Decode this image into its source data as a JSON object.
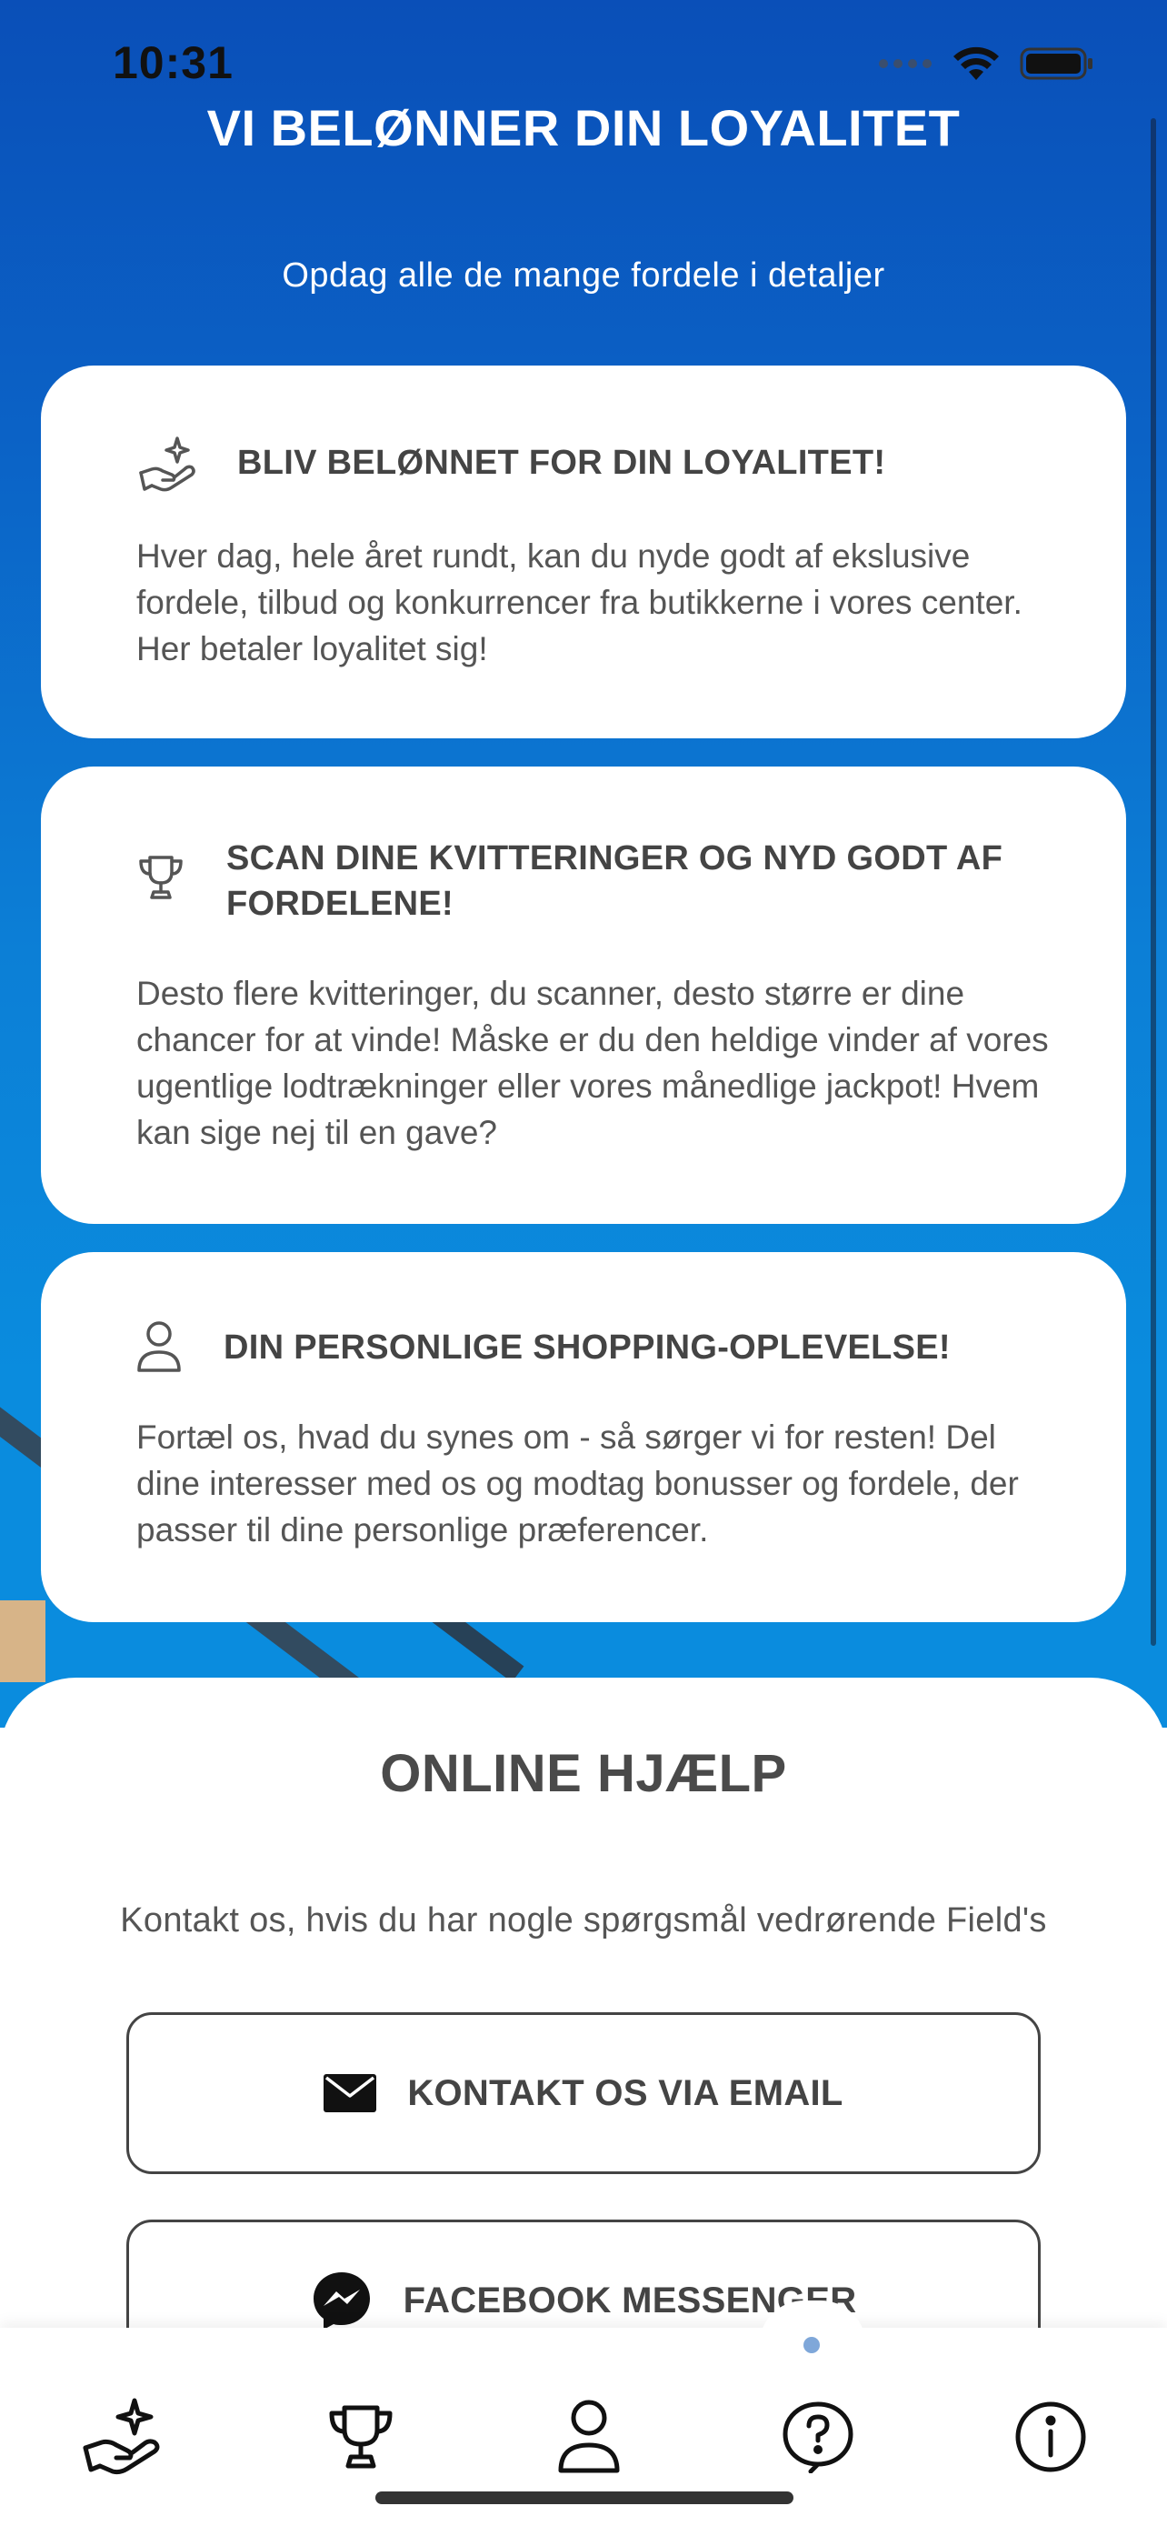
{
  "status_bar": {
    "time": "10:31"
  },
  "hero": {
    "title": "VI BELØNNER DIN LOYALITET",
    "subtitle": "Opdag alle de mange fordele i detaljer"
  },
  "cards": [
    {
      "icon": "hand-sparkle-icon",
      "title": "BLIV BELØNNET FOR DIN LOYALITET!",
      "body": "Hver dag, hele året rundt, kan du nyde godt af ekslusive fordele, tilbud og konkurrencer fra butikkerne i vores center. Her betaler loyalitet sig!"
    },
    {
      "icon": "trophy-icon",
      "title": "SCAN DINE KVITTERINGER OG NYD GODT AF FORDELENE!",
      "body": "Desto flere kvitteringer, du scanner, desto større er dine chancer for at vinde! Måske er du den heldige vinder af vores ugentlige lodtrækninger eller vores månedlige jackpot! Hvem kan sige nej til en gave?"
    },
    {
      "icon": "user-icon",
      "title": "DIN PERSONLIGE SHOPPING-OPLEVELSE!",
      "body": "Fortæl os, hvad du synes om - så sørger vi for resten! Del dine interesser med os og modtag bonusser og fordele, der passer til dine personlige præferencer."
    }
  ],
  "help": {
    "title": "ONLINE HJÆLP",
    "subtitle": "Kontakt os, hvis du har nogle spørgsmål vedrørende Field's",
    "email_button": "KONTAKT OS VIA EMAIL",
    "messenger_button": "FACEBOOK MESSENGER"
  },
  "tabbar": {
    "items": [
      "hand-sparkle-icon",
      "trophy-icon",
      "user-icon",
      "help-icon",
      "info-icon"
    ],
    "active_index": 3,
    "active_indicator_color": "#7fa7d9"
  },
  "colors": {
    "hero_top": "#0a4fb8",
    "hero_bottom": "#0a8cde",
    "card_text": "#555555",
    "title_text": "#444444"
  }
}
